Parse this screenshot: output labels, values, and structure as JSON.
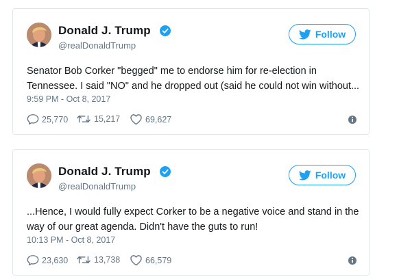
{
  "tweets": [
    {
      "name": "Donald J. Trump",
      "handle": "@realDonaldTrump",
      "follow_label": "Follow",
      "text": "Senator Bob Corker \"begged\" me to endorse him for re-election in Tennessee. I said \"NO\" and he dropped out (said he could not win without...",
      "timestamp": "9:59 PM - Oct 8, 2017",
      "replies": "25,770",
      "retweets": "15,217",
      "likes": "69,627"
    },
    {
      "name": "Donald J. Trump",
      "handle": "@realDonaldTrump",
      "follow_label": "Follow",
      "text": "...Hence, I would fully expect Corker to be a negative voice and stand in the way of our great agenda. Didn't have the guts to run!",
      "timestamp": "10:13 PM - Oct 8, 2017",
      "replies": "23,630",
      "retweets": "13,738",
      "likes": "66,579"
    }
  ],
  "colors": {
    "accent": "#1da1f2",
    "text": "#14171a",
    "secondary": "#657786",
    "border": "#e1e8ed"
  },
  "icons": [
    "verified-badge-icon",
    "twitter-bird-icon",
    "reply-icon",
    "retweet-icon",
    "like-heart-icon",
    "info-icon"
  ]
}
